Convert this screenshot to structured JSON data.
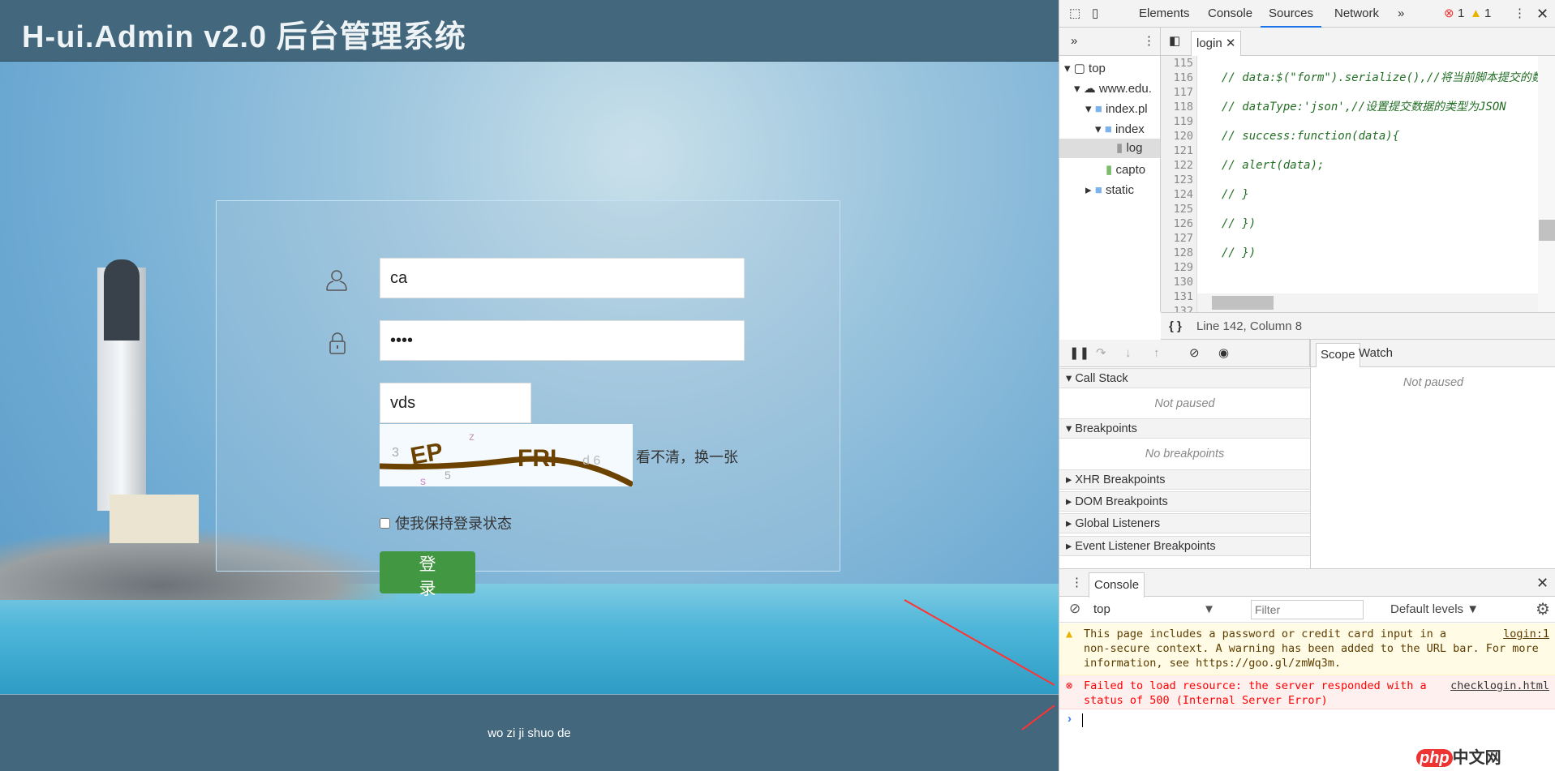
{
  "page": {
    "header_title": "H-ui.Admin v2.0 后台管理系统",
    "username_value": "ca",
    "password_value": "••••",
    "captcha_value": "vds",
    "captcha_refresh_link": "看不清，换一张",
    "remember_label": "使我保持登录状态",
    "login_button": "登　录",
    "footer_text": "wo zi ji shuo de",
    "accent_color": "#429842"
  },
  "devtools": {
    "tabs": [
      "Elements",
      "Console",
      "Sources",
      "Network"
    ],
    "active_tab": "Sources",
    "more_tabs": "»",
    "error_count": "1",
    "warning_count": "1",
    "navigator": {
      "more": "»",
      "tree": [
        "top",
        "www.edu.",
        "index.pl",
        "index",
        "log",
        "capto",
        "static"
      ]
    },
    "editor_tab": "login",
    "line_numbers": [
      "115",
      "116",
      "117",
      "118",
      "119",
      "120",
      "121",
      "122",
      "123",
      "124",
      "125",
      "126",
      "127",
      "128",
      "129",
      "130",
      "131",
      "132"
    ],
    "code_lines": [
      {
        "line": "116",
        "text": "// data:$(\"form\").serialize(),//将当前脚本提交的数"
      },
      {
        "line": "118",
        "text": "// dataType:'json',//设置提交数据的类型为JSON"
      },
      {
        "line": "120",
        "text": "// success:function(data){"
      },
      {
        "line": "122",
        "text": "// alert(data);"
      },
      {
        "line": "124",
        "text": "// }"
      },
      {
        "line": "126",
        "text": "// })"
      },
      {
        "line": "128",
        "text": "// })"
      }
    ],
    "status": {
      "pretty_print": "{ }",
      "position": "Line 142, Column 8"
    },
    "sidebar_tabs": [
      "Scope",
      "Watch"
    ],
    "scope_status": "Not paused",
    "sections": {
      "call_stack": "Call Stack",
      "call_stack_status": "Not paused",
      "breakpoints": "Breakpoints",
      "breakpoints_status": "No breakpoints",
      "xhr": "XHR Breakpoints",
      "dom": "DOM Breakpoints",
      "global": "Global Listeners",
      "event": "Event Listener Breakpoints"
    },
    "console": {
      "tab": "Console",
      "context": "top",
      "filter_placeholder": "Filter",
      "levels": "Default levels",
      "warning": {
        "text": "This page includes a password or credit card input in a non-secure context. A warning has been added to the URL bar. For more information, see ",
        "link": "https://goo.gl/zmWq3m",
        "after": ".",
        "source": "login:1"
      },
      "error": {
        "text": "Failed to load resource: the server responded with a status of 500 (Internal Server Error)",
        "source": "checklogin.html"
      }
    }
  },
  "watermark": "php中文网"
}
